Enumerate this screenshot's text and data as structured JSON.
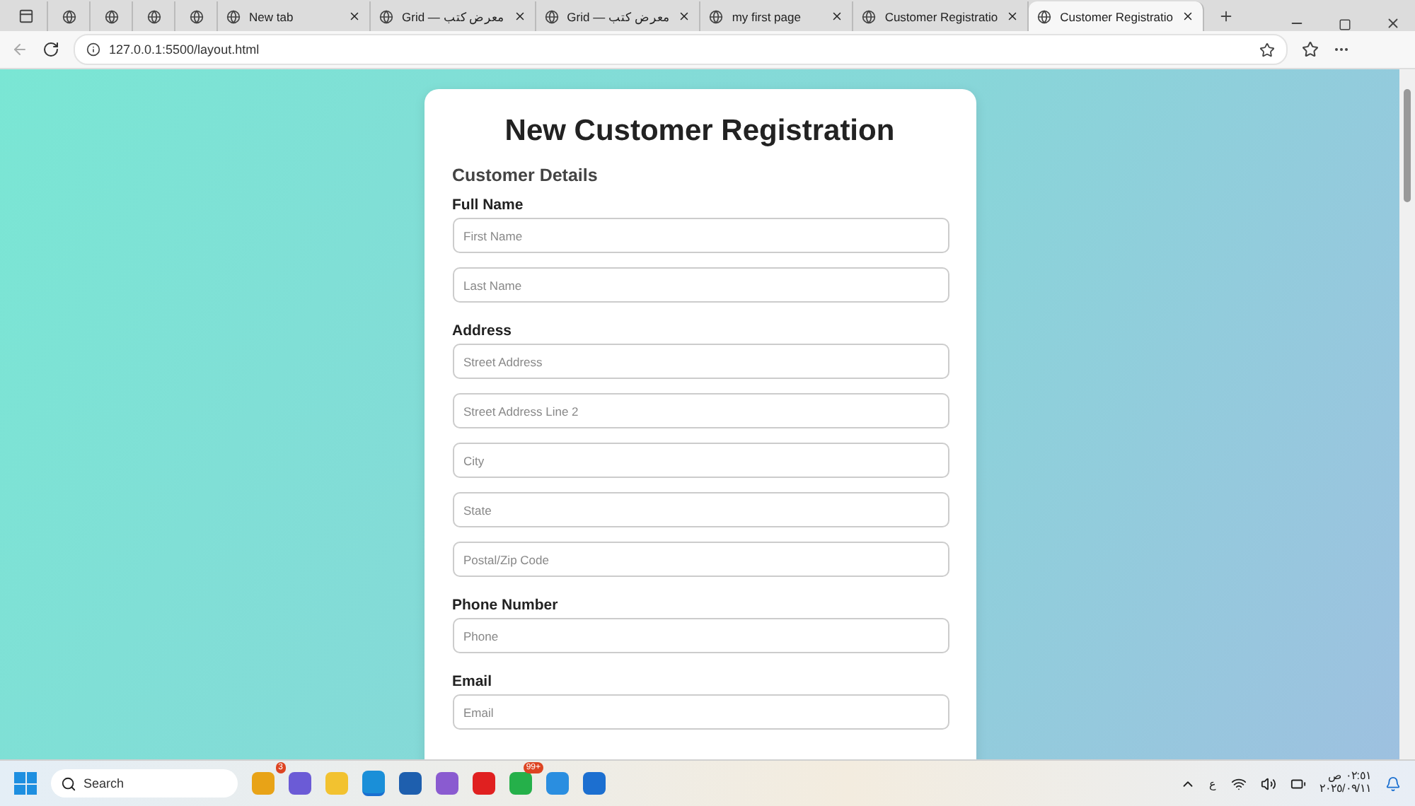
{
  "tabs": [
    {
      "kind": "icon",
      "selected": false
    },
    {
      "kind": "icon",
      "selected": false
    },
    {
      "kind": "icon",
      "selected": false
    },
    {
      "kind": "icon",
      "selected": false
    },
    {
      "kind": "icon",
      "selected": false
    },
    {
      "kind": "full",
      "label": "New tab",
      "selected": false
    },
    {
      "kind": "full",
      "label": "Grid — معرض كتب",
      "selected": false
    },
    {
      "kind": "full",
      "label": "Grid — معرض كتب",
      "selected": false
    },
    {
      "kind": "full",
      "label": "my first page",
      "selected": false
    },
    {
      "kind": "full",
      "label": "Customer Registratio",
      "selected": false
    },
    {
      "kind": "full",
      "label": "Customer Registratio",
      "selected": true
    }
  ],
  "address_bar": {
    "url": "127.0.0.1:5500/layout.html"
  },
  "form": {
    "title": "New Customer Registration",
    "section": "Customer Details",
    "groups": [
      {
        "label": "Full Name",
        "fields": [
          {
            "placeholder": "First Name"
          },
          {
            "placeholder": "Last Name"
          }
        ]
      },
      {
        "label": "Address",
        "fields": [
          {
            "placeholder": "Street Address"
          },
          {
            "placeholder": "Street Address Line 2"
          },
          {
            "placeholder": "City"
          },
          {
            "placeholder": "State"
          },
          {
            "placeholder": "Postal/Zip Code"
          }
        ]
      },
      {
        "label": "Phone Number",
        "fields": [
          {
            "placeholder": "Phone"
          }
        ]
      },
      {
        "label": "Email",
        "fields": [
          {
            "placeholder": "Email"
          }
        ]
      }
    ]
  },
  "taskbar": {
    "search": {
      "placeholder": "Search"
    },
    "apps": [
      {
        "color": "#e8a317",
        "badge": "3",
        "active": false
      },
      {
        "color": "#6b5bd6",
        "active": false
      },
      {
        "color": "#f2c230",
        "active": false
      },
      {
        "color": "#1a8fd8",
        "active": true
      },
      {
        "color": "#1e5fae",
        "active": false
      },
      {
        "color": "#8a5bd0",
        "active": false
      },
      {
        "color": "#e02020",
        "active": false
      },
      {
        "color": "#25b04a",
        "badge": "99+",
        "active": false
      },
      {
        "color": "#2a8ee0",
        "active": false
      },
      {
        "color": "#1c6fd0",
        "active": false
      }
    ],
    "language": "ع",
    "time": "٠٢:٥١ ص",
    "date": "٢٠٢٥/٠٩/١١"
  }
}
